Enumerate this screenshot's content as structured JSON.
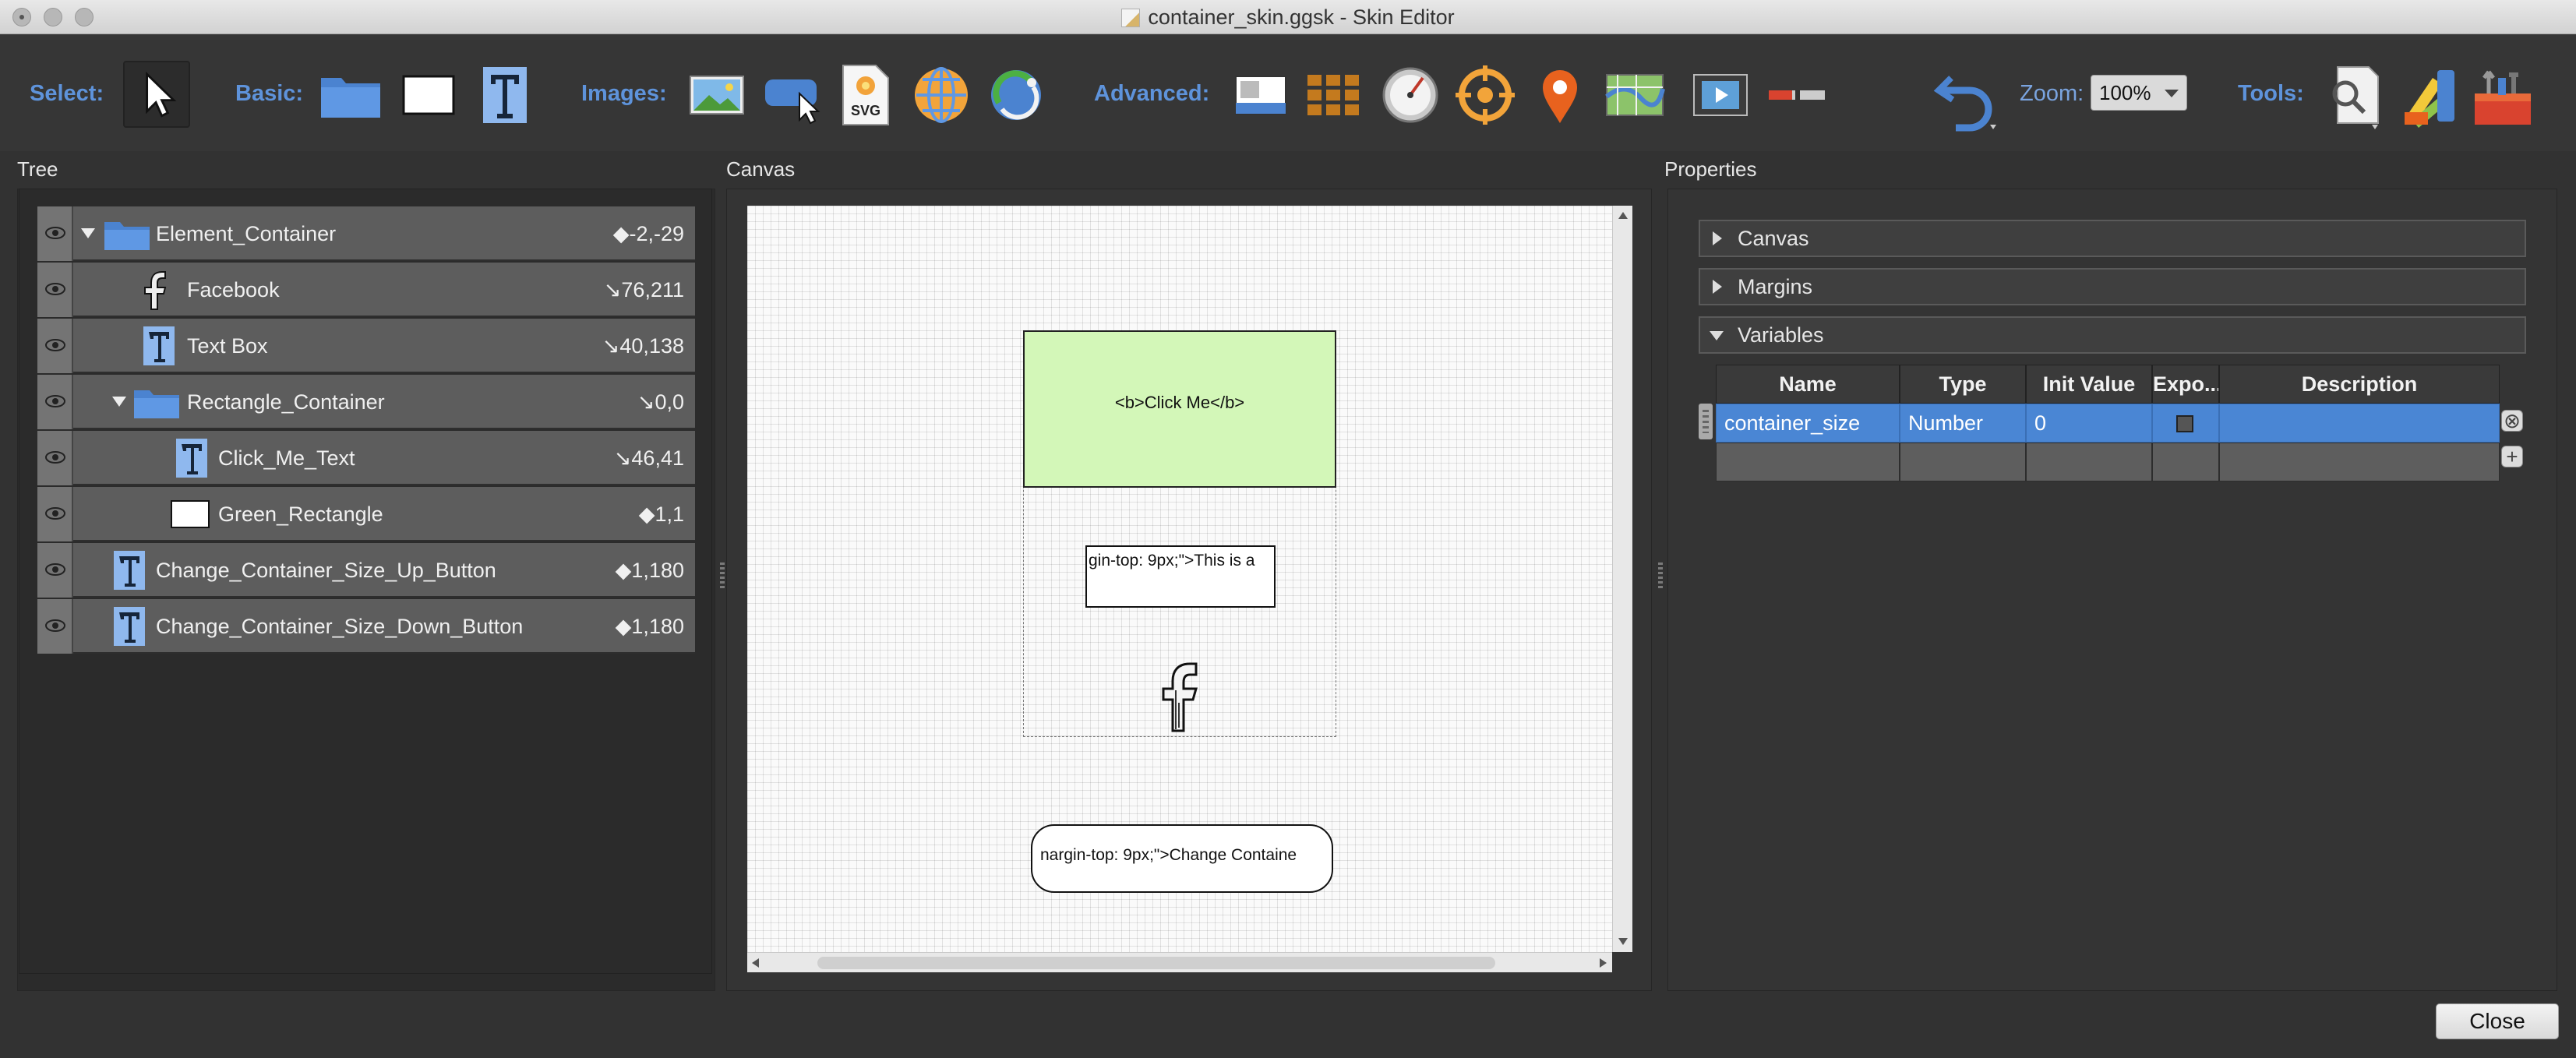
{
  "window": {
    "title": "container_skin.ggsk - Skin Editor"
  },
  "toolbar": {
    "select_label": "Select:",
    "basic_label": "Basic:",
    "images_label": "Images:",
    "advanced_label": "Advanced:",
    "zoom_label": "Zoom:",
    "zoom_value": "100%",
    "tools_label": "Tools:",
    "svg_icon_text": "SVG"
  },
  "panels": {
    "tree_title": "Tree",
    "canvas_title": "Canvas",
    "properties_title": "Properties"
  },
  "tree": {
    "rows": [
      {
        "label": "Element_Container",
        "pos": "◆-2,-29",
        "icon": "folder-icon"
      },
      {
        "label": "Facebook",
        "pos": "↘76,211",
        "icon": "facebook-image-icon"
      },
      {
        "label": "Text Box",
        "pos": "↘40,138",
        "icon": "text-icon"
      },
      {
        "label": "Rectangle_Container",
        "pos": "↘0,0",
        "icon": "folder-icon"
      },
      {
        "label": "Click_Me_Text",
        "pos": "↘46,41",
        "icon": "text-icon"
      },
      {
        "label": "Green_Rectangle",
        "pos": "◆1,1",
        "icon": "rectangle-icon"
      },
      {
        "label": "Change_Container_Size_Up_Button",
        "pos": "◆1,180",
        "icon": "text-icon"
      },
      {
        "label": "Change_Container_Size_Down_Button",
        "pos": "◆1,180",
        "icon": "text-icon"
      }
    ]
  },
  "canvas": {
    "click_me_text": "<b>Click Me</b>",
    "textbox_text": "gin-top: 9px;\">This is a",
    "button_text": "nargin-top: 9px;\">Change Containe"
  },
  "properties": {
    "sections": [
      {
        "label": "Canvas",
        "expanded": false
      },
      {
        "label": "Margins",
        "expanded": false
      },
      {
        "label": "Variables",
        "expanded": true
      }
    ],
    "variables_table": {
      "columns": [
        "Name",
        "Type",
        "Init Value",
        "Expo...",
        "Description"
      ],
      "rows": [
        {
          "name": "container_size",
          "type": "Number",
          "init_value": "0",
          "exported": false,
          "description": ""
        }
      ]
    }
  },
  "footer": {
    "close_label": "Close"
  },
  "colors": {
    "accent_label": "#5e93db",
    "selection": "#4a86d4",
    "green_rectangle": "#d3f7b8"
  }
}
